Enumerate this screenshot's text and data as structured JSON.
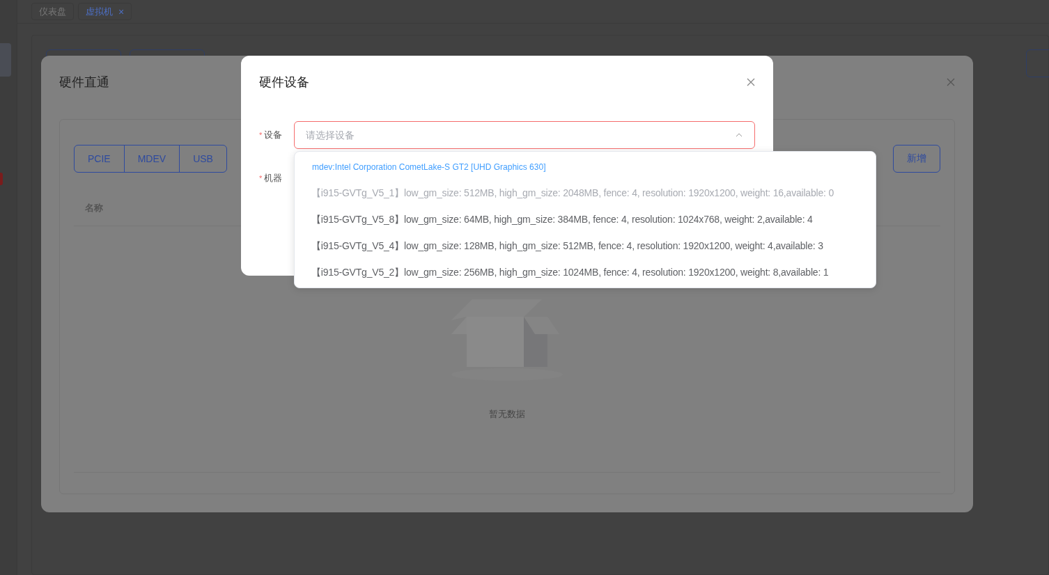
{
  "tabs": [
    {
      "label": "仪表盘",
      "selected": false
    },
    {
      "label": "虚拟机",
      "selected": true,
      "close": "×"
    }
  ],
  "passthrough_dialog": {
    "title": "硬件直通",
    "segments": [
      "PCIE",
      "MDEV",
      "USB"
    ],
    "add_button": "新增",
    "table": {
      "columns": [
        "名称"
      ],
      "empty_text": "暂无数据"
    }
  },
  "device_dialog": {
    "title": "硬件设备",
    "fields": [
      {
        "label": "设备",
        "required_mark": "*",
        "placeholder": "请选择设备",
        "error": true
      },
      {
        "label": "机器",
        "required_mark": "*"
      }
    ]
  },
  "dropdown": [
    {
      "kind": "group",
      "text": "mdev:Intel Corporation CometLake-S GT2 [UHD Graphics 630]"
    },
    {
      "kind": "option",
      "disabled": true,
      "text": "【i915-GVTg_V5_1】low_gm_size: 512MB, high_gm_size: 2048MB, fence: 4, resolution: 1920x1200, weight: 16,available: 0"
    },
    {
      "kind": "option",
      "disabled": false,
      "text": "【i915-GVTg_V5_8】low_gm_size: 64MB, high_gm_size: 384MB, fence: 4, resolution: 1024x768, weight: 2,available: 4"
    },
    {
      "kind": "option",
      "disabled": false,
      "text": "【i915-GVTg_V5_4】low_gm_size: 128MB, high_gm_size: 512MB, fence: 4, resolution: 1920x1200, weight: 4,available: 3"
    },
    {
      "kind": "option",
      "disabled": false,
      "text": "【i915-GVTg_V5_2】low_gm_size: 256MB, high_gm_size: 1024MB, fence: 4, resolution: 1920x1200, weight: 8,available: 1"
    }
  ]
}
